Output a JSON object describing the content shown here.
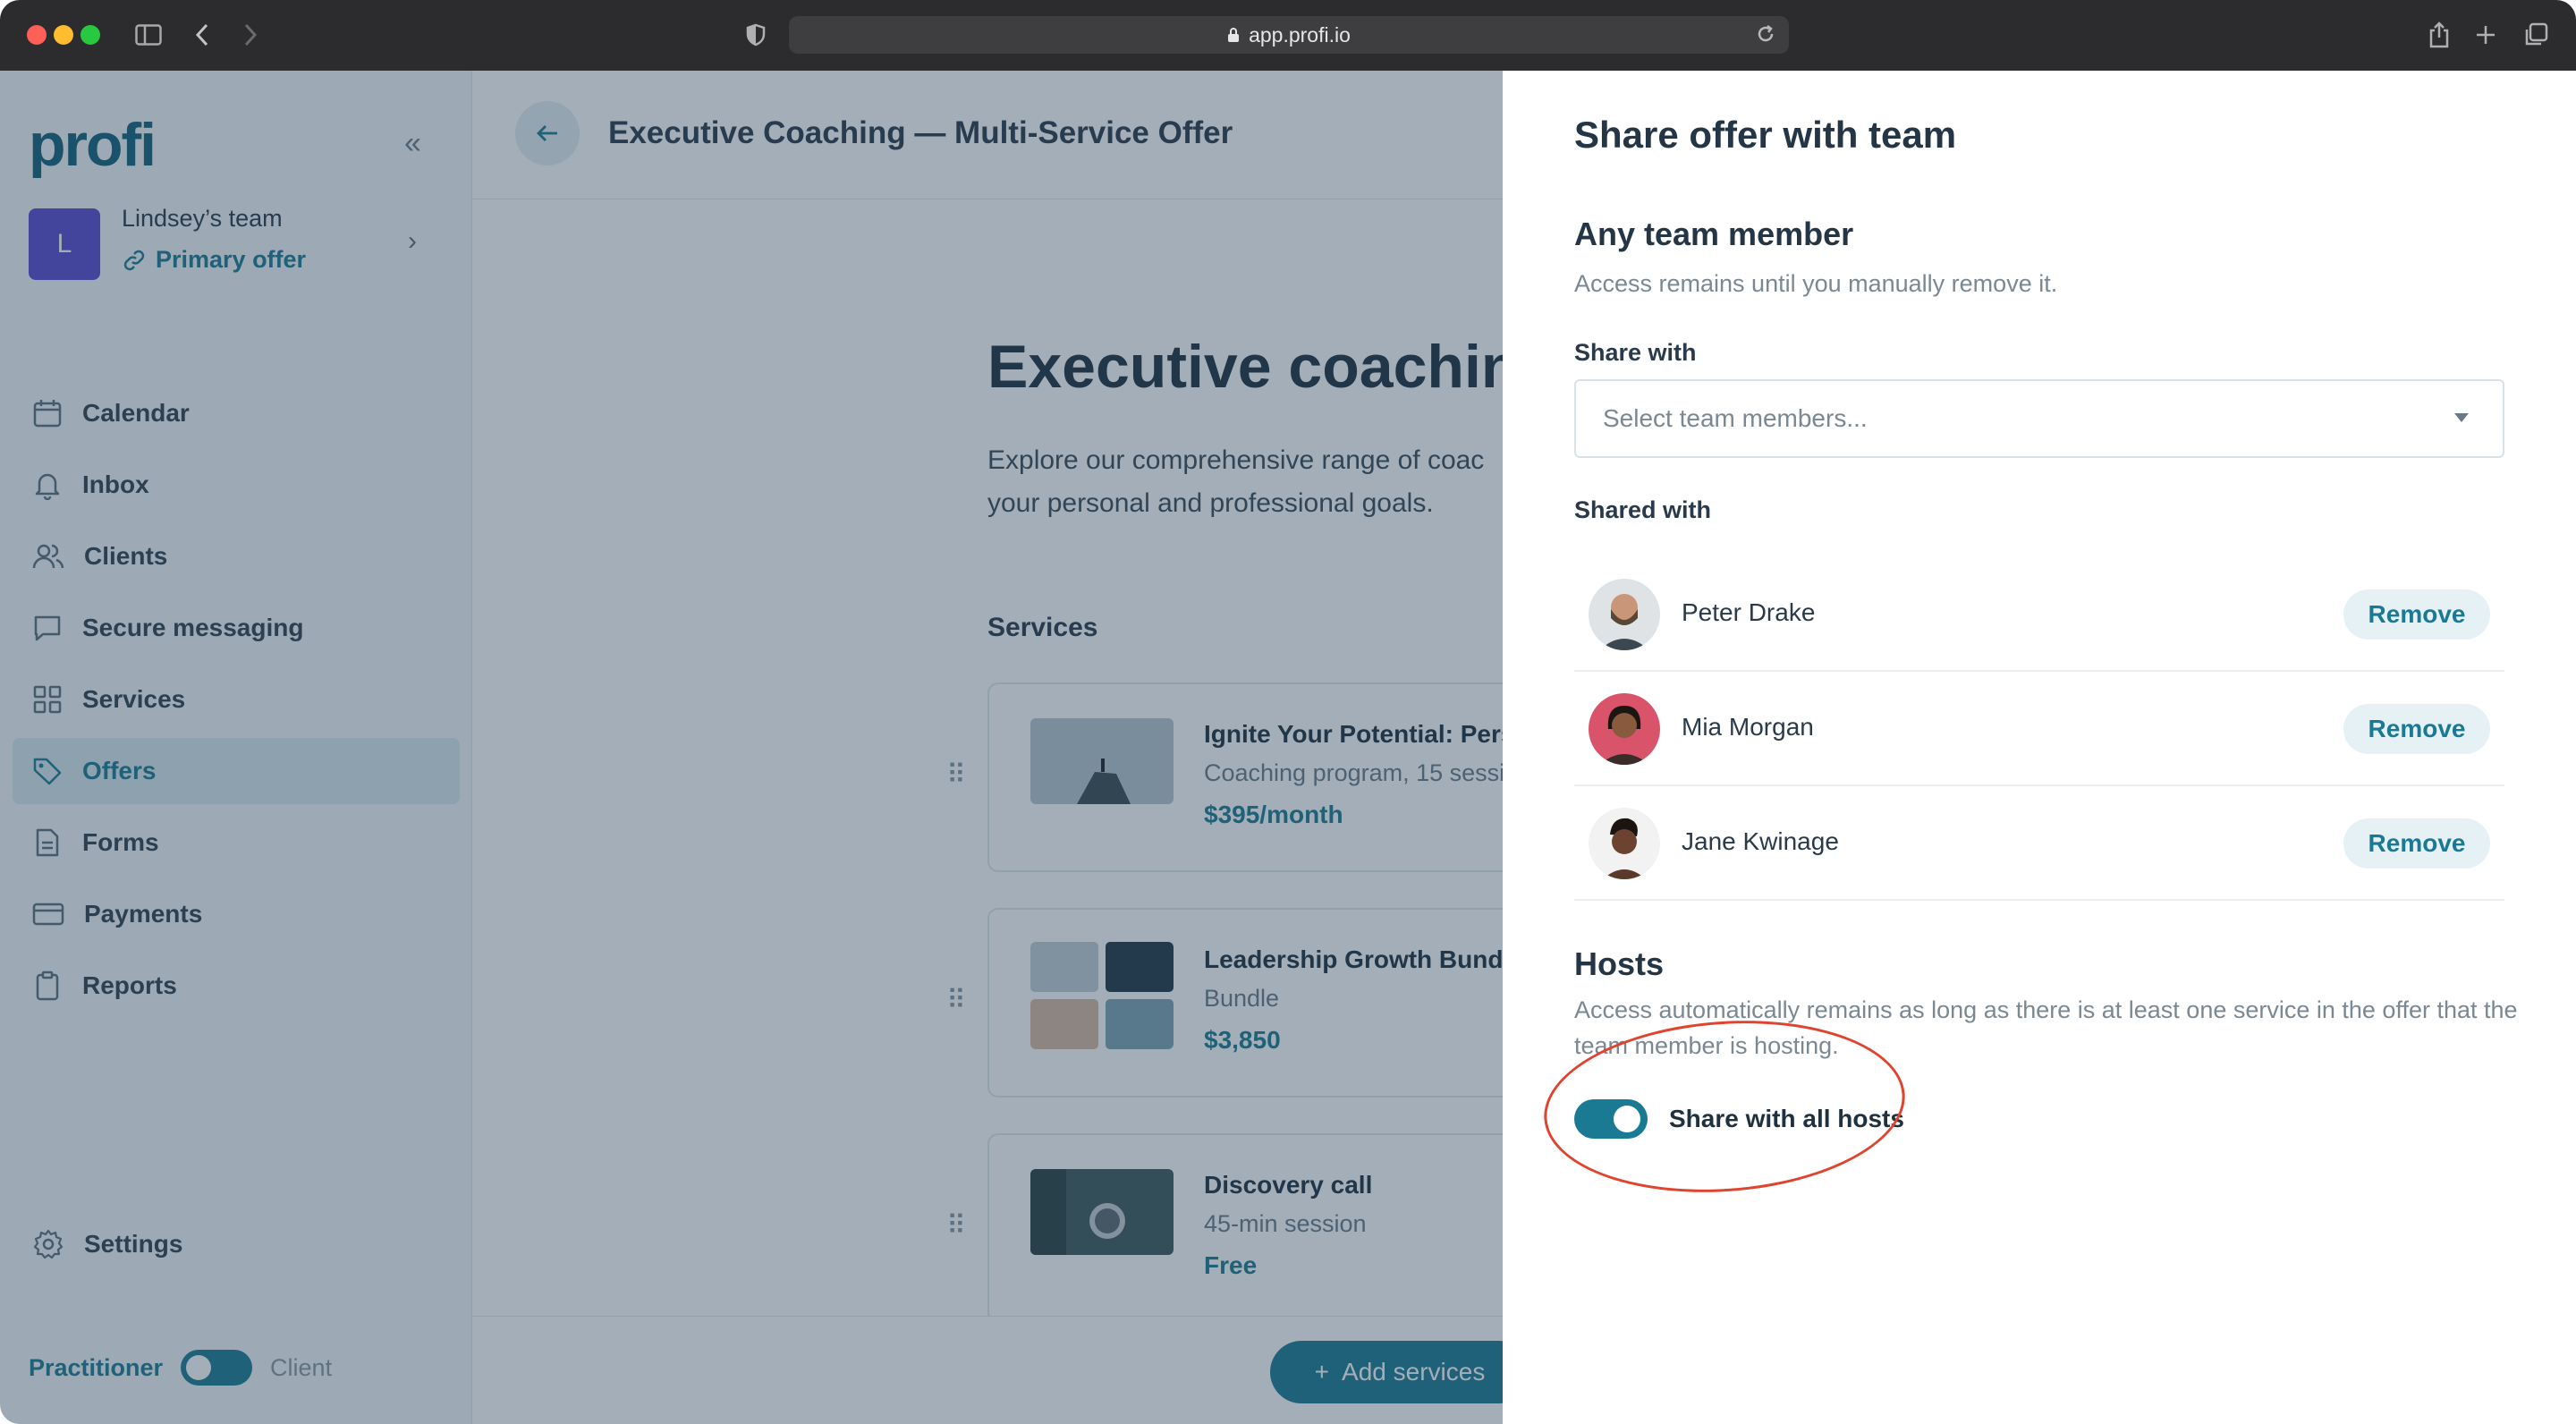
{
  "browser": {
    "url": "app.profi.io"
  },
  "sidebar": {
    "logo": "profi",
    "team": {
      "avatar_letter": "L",
      "name": "Lindsey’s team",
      "offer": "Primary offer"
    },
    "items": [
      {
        "label": "Calendar",
        "icon": "calendar-icon"
      },
      {
        "label": "Inbox",
        "icon": "bell-icon"
      },
      {
        "label": "Clients",
        "icon": "users-icon"
      },
      {
        "label": "Secure messaging",
        "icon": "chat-icon"
      },
      {
        "label": "Services",
        "icon": "grid-icon"
      },
      {
        "label": "Offers",
        "icon": "tag-icon",
        "active": true
      },
      {
        "label": "Forms",
        "icon": "document-icon"
      },
      {
        "label": "Payments",
        "icon": "card-icon"
      },
      {
        "label": "Reports",
        "icon": "clipboard-icon"
      }
    ],
    "settings": "Settings",
    "mode": {
      "left": "Practitioner",
      "right": "Client"
    }
  },
  "main": {
    "title": "Executive Coaching — Multi-Service Offer",
    "hero_title": "Executive coaching",
    "hero_desc_line1": "Explore our comprehensive range of coac",
    "hero_desc_line2": "your personal and professional goals.",
    "services_heading": "Services",
    "services": [
      {
        "name": "Ignite Your Potential: Perso",
        "sub": "Coaching program, 15 sessi",
        "price": "$395/month"
      },
      {
        "name": "Leadership Growth Bundle",
        "sub": "Bundle",
        "price": "$3,850"
      },
      {
        "name": "Discovery call",
        "sub": "45-min session",
        "price": "Free"
      }
    ],
    "add_services": "Add services"
  },
  "panel": {
    "title": "Share offer with team",
    "any_member": {
      "heading": "Any team member",
      "help": "Access remains until you manually remove it.",
      "share_with_label": "Share with",
      "select_placeholder": "Select team members...",
      "shared_with_label": "Shared with",
      "members": [
        {
          "name": "Peter Drake",
          "action": "Remove"
        },
        {
          "name": "Mia Morgan",
          "action": "Remove"
        },
        {
          "name": "Jane Kwinage",
          "action": "Remove"
        }
      ]
    },
    "hosts": {
      "heading": "Hosts",
      "help": "Access automatically remains as long as there is at least one service in the offer that the team member is hosting.",
      "toggle_label": "Share with all hosts",
      "toggle_on": true
    }
  },
  "colors": {
    "accent": "#1a7a93",
    "overlay": "#233e55",
    "annotation": "#e0442f"
  }
}
